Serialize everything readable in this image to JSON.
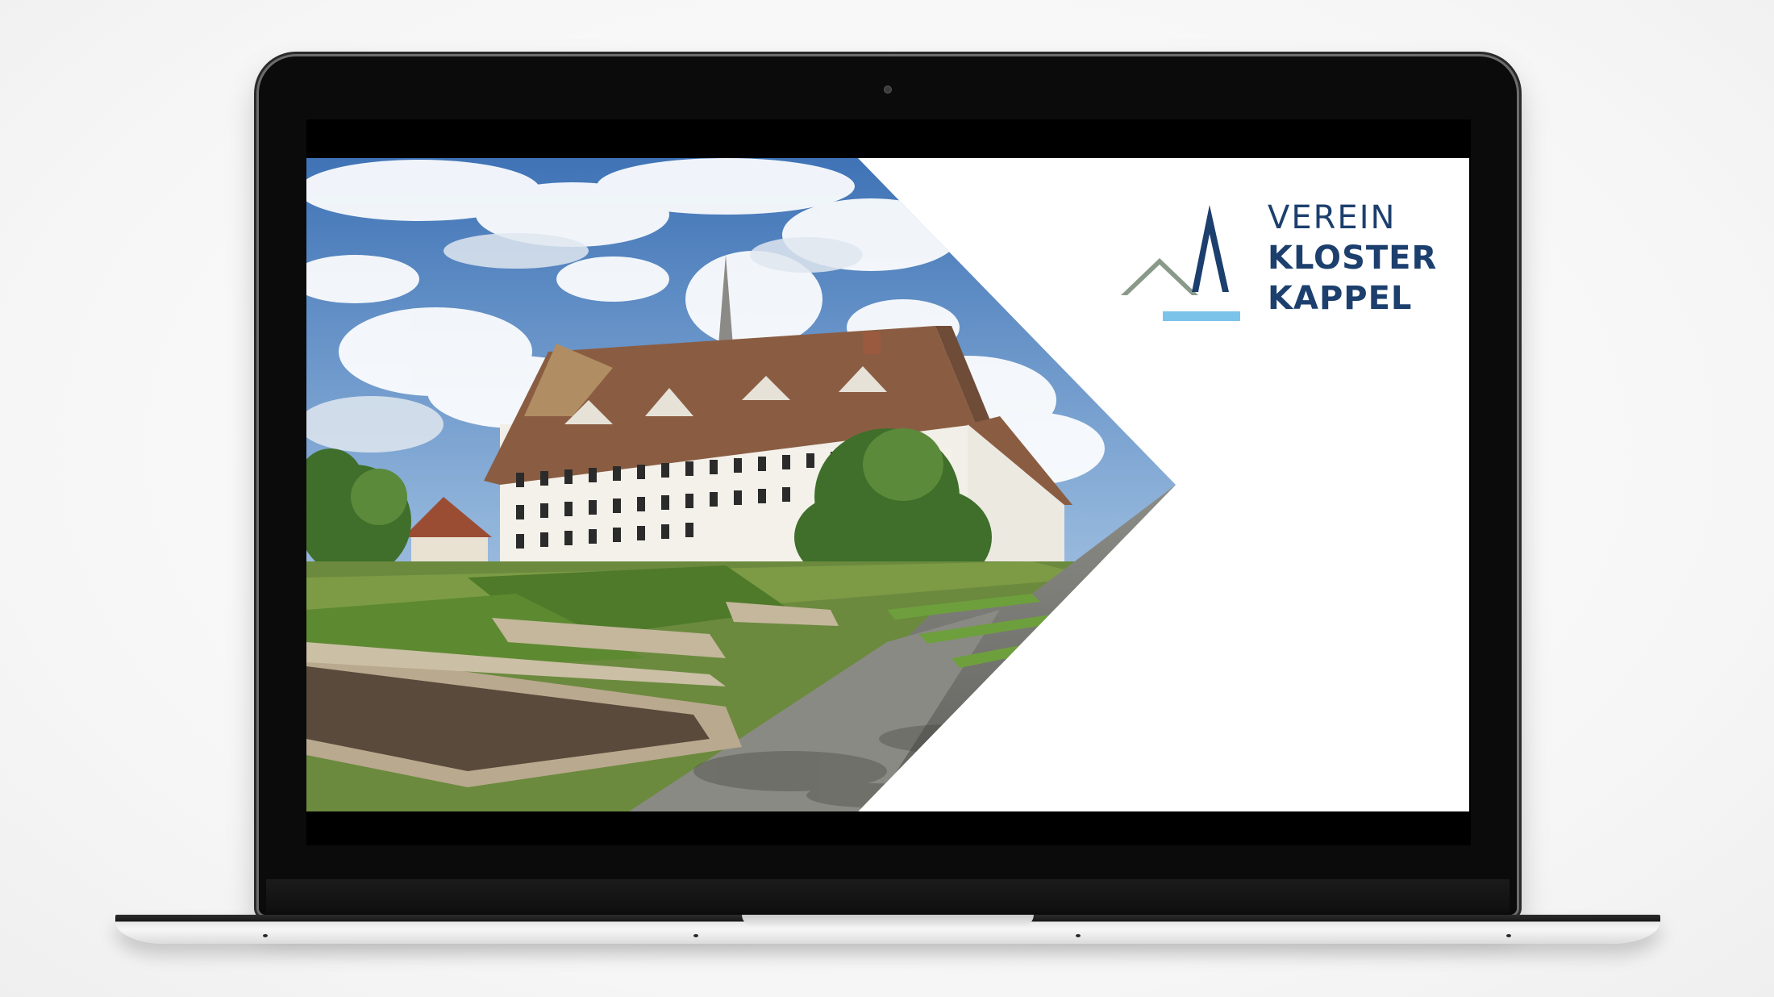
{
  "device": "laptop-mockup",
  "screen": {
    "background_color": "#ffffff",
    "photo": {
      "subject": "monastery-building-with-garden",
      "icon": "landscape-photo"
    },
    "logo": {
      "line1": "VEREIN",
      "line2": "KLOSTER",
      "line3": "KAPPEL",
      "colors": {
        "text": "#1c3f6e",
        "spire": "#1c3f6e",
        "roof": "#8a9a8a",
        "underline": "#7cc3ea"
      }
    }
  }
}
